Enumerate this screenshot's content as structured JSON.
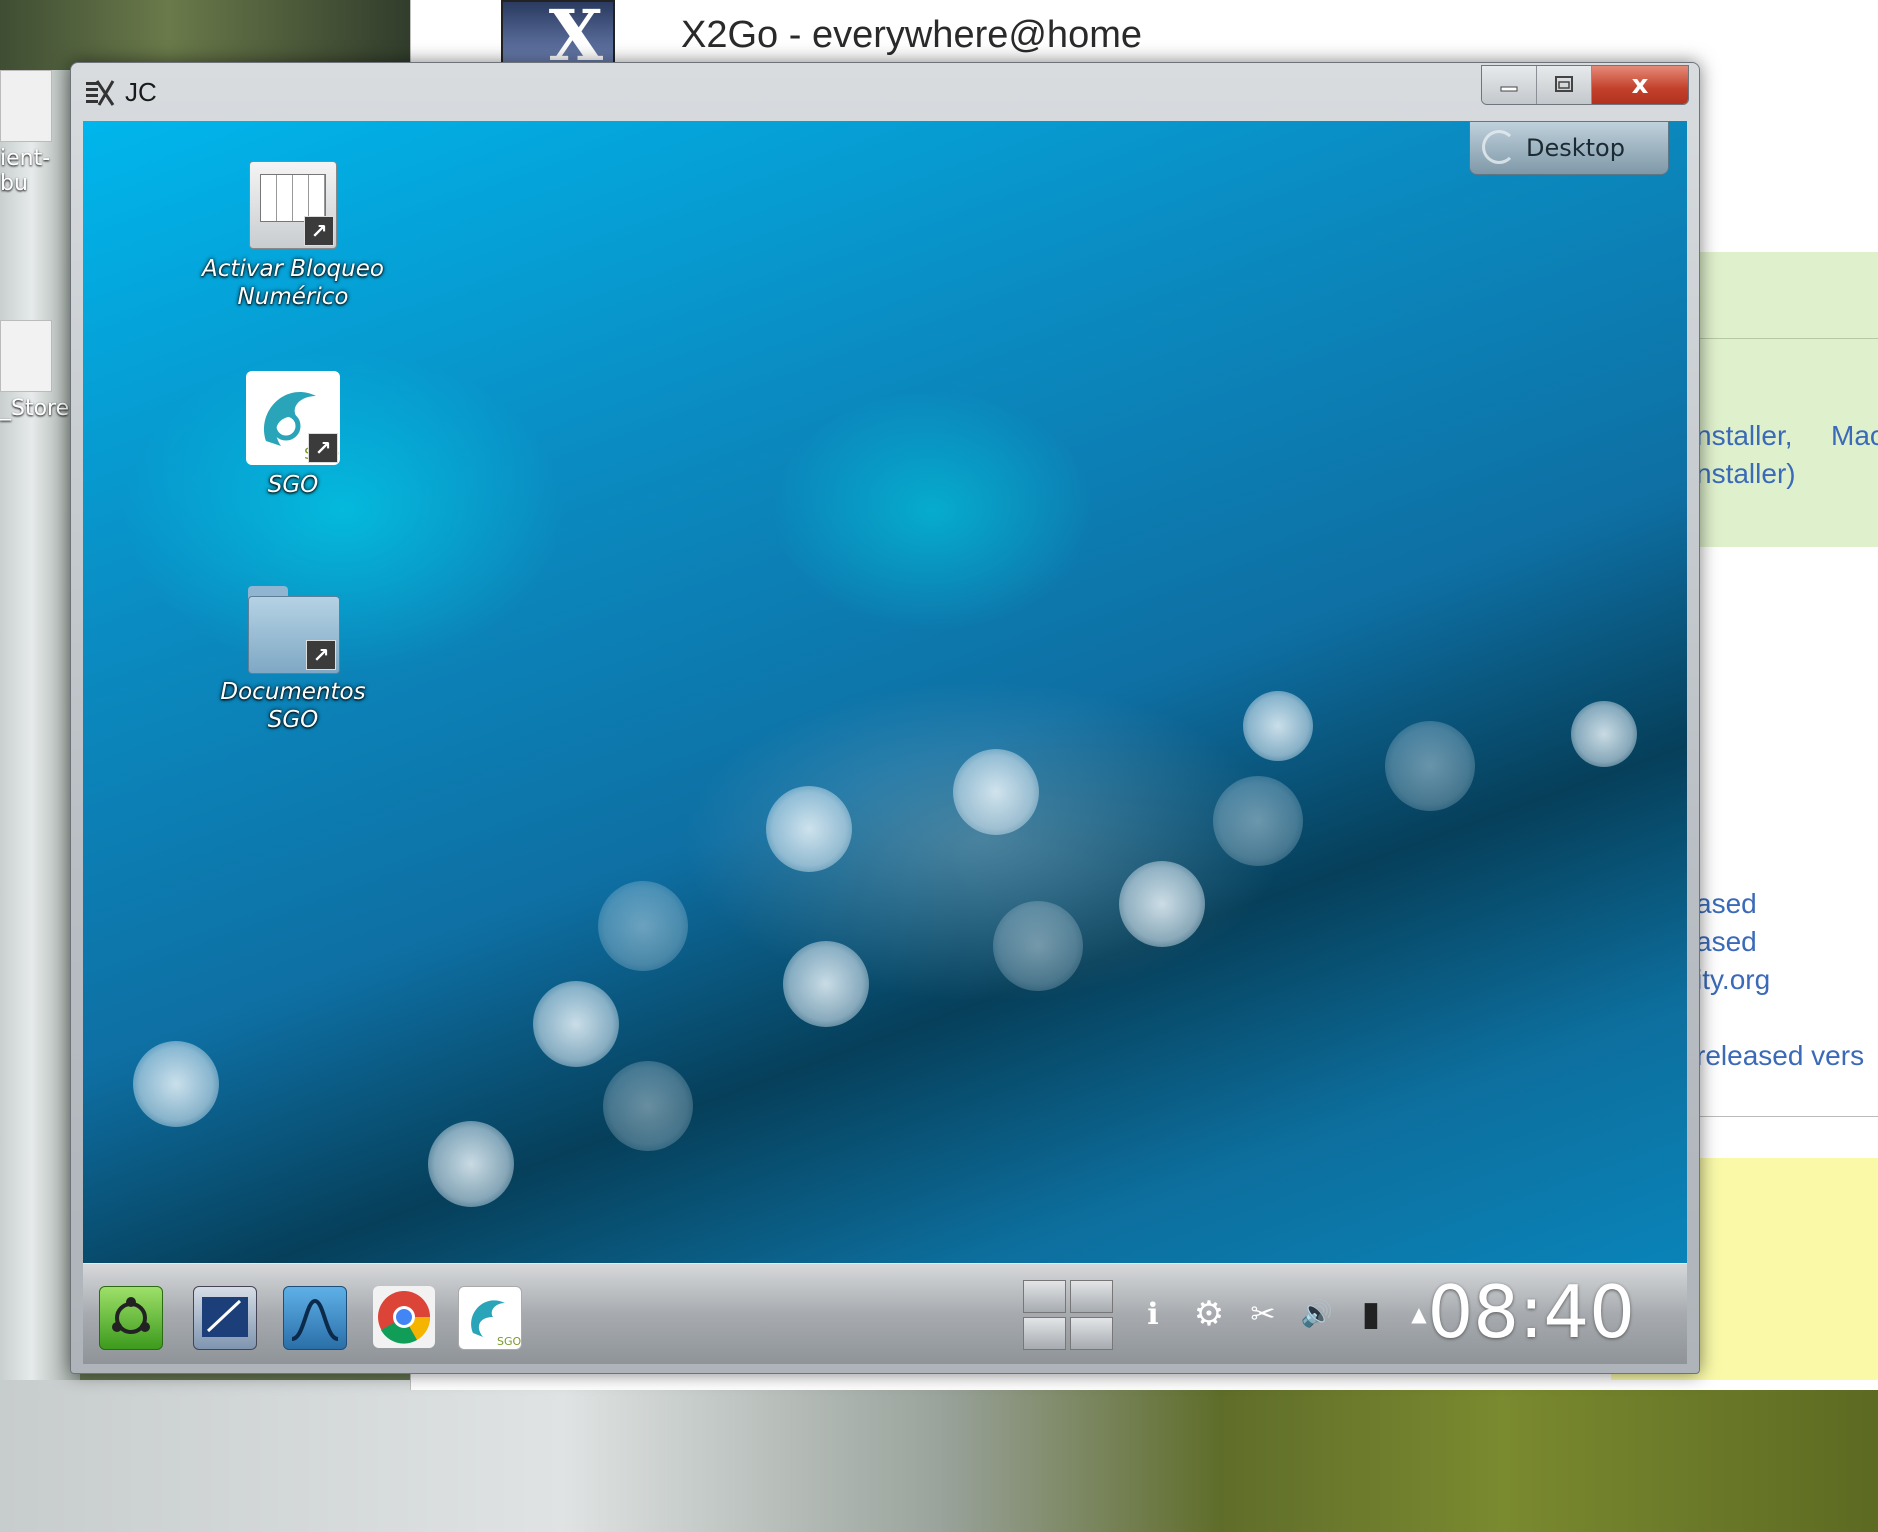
{
  "outer_desktop": {
    "icons": [
      {
        "label": "ient-bu"
      },
      {
        "label": "_Store"
      }
    ]
  },
  "browser": {
    "title": "X2Go - everywhere@home",
    "links": [
      "nstaller,",
      "Mac",
      "nstaller)",
      "ased",
      "ased",
      "ity.org",
      "released vers"
    ]
  },
  "window": {
    "title": "JC",
    "buttons": {
      "minimize": "minimize",
      "maximize": "maximize",
      "close": "x"
    }
  },
  "remote_desktop": {
    "toolbox_label": "Desktop",
    "icons": [
      {
        "label": "Activar Bloqueo\nNumérico",
        "icon": "keyboard-shortcut-icon"
      },
      {
        "label": "SGO",
        "icon": "sgo-app-icon"
      },
      {
        "label": "Documentos\nSGO",
        "icon": "folder-icon"
      }
    ]
  },
  "panel": {
    "launchers": [
      {
        "name": "kickoff-menu-icon"
      },
      {
        "name": "screenshot-tool-icon"
      },
      {
        "name": "wireshark-icon"
      },
      {
        "name": "chrome-icon"
      },
      {
        "name": "sgo-app-icon"
      }
    ],
    "tray": [
      {
        "name": "info-icon",
        "glyph": "ℹ"
      },
      {
        "name": "settings-icon",
        "glyph": "⚙"
      },
      {
        "name": "clipboard-icon",
        "glyph": "✂"
      },
      {
        "name": "volume-icon",
        "glyph": "🔊"
      },
      {
        "name": "battery-icon",
        "glyph": "▮"
      },
      {
        "name": "tray-expand-icon",
        "glyph": "▲"
      }
    ],
    "clock": "08:40"
  },
  "colors": {
    "accent_blue": "#0a8cc2",
    "close_red": "#c3402b",
    "link_blue": "#3a6ab8"
  }
}
